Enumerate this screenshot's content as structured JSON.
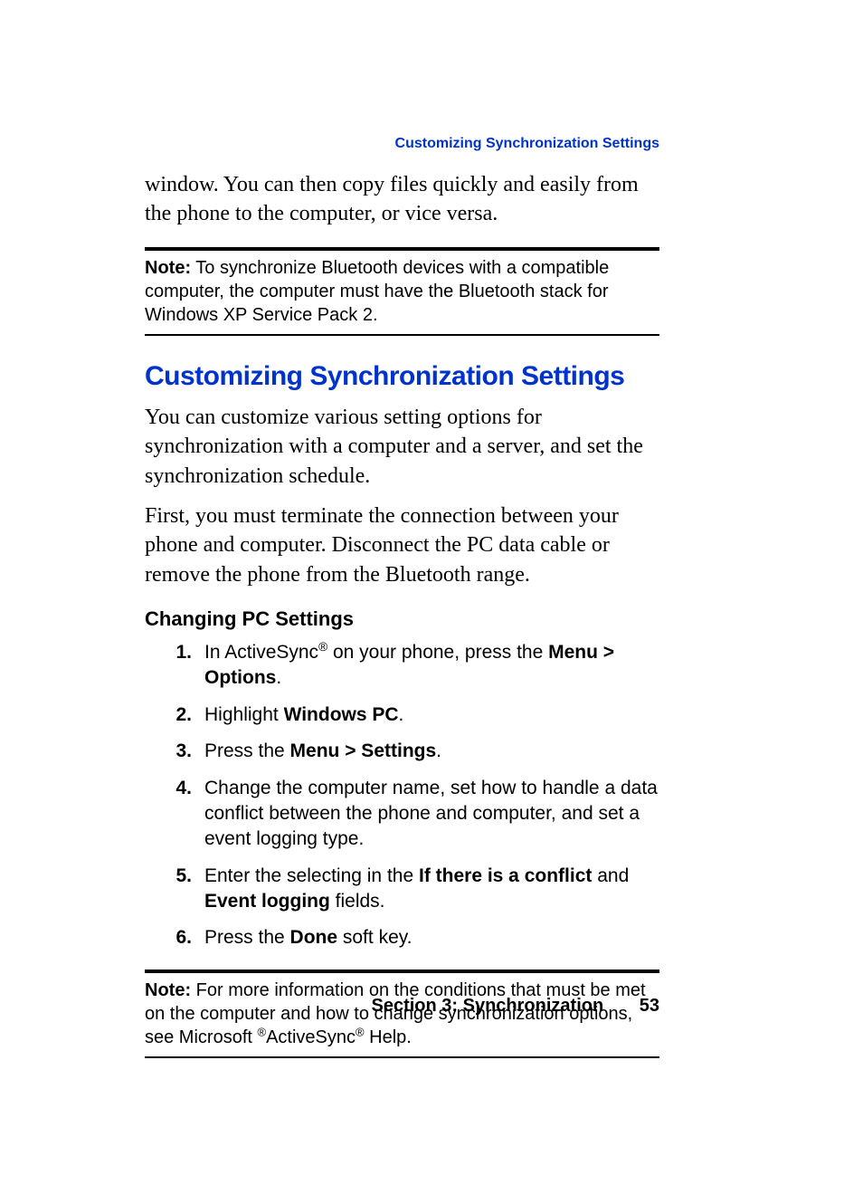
{
  "running_head": "Customizing Synchronization Settings",
  "intro_continuation": "window. You can then copy files quickly and easily from the phone to the computer, or vice versa.",
  "note1": {
    "label": "Note:",
    "text": " To synchronize Bluetooth devices with a compatible computer, the computer must have the Bluetooth stack for Windows XP Service Pack 2."
  },
  "heading": "Customizing Synchronization Settings",
  "para1": "You can customize various setting options for synchronization with a computer and a server, and set the synchronization schedule.",
  "para2": "First, you must terminate the connection between your phone and computer. Disconnect the PC data cable or remove the phone from the Bluetooth range.",
  "subheading": "Changing PC Settings",
  "steps": [
    {
      "n": "1.",
      "pre": "In ActiveSync",
      "sup": "®",
      "mid": " on your phone, press the ",
      "bold": "Menu > Options",
      "post": "."
    },
    {
      "n": "2.",
      "pre": "Highlight ",
      "bold": "Windows PC",
      "post": "."
    },
    {
      "n": "3.",
      "pre": "Press the ",
      "bold": "Menu > Settings",
      "post": "."
    },
    {
      "n": "4.",
      "text": "Change the computer name, set how to handle a data conflict between the phone and computer, and set a event logging type."
    },
    {
      "n": "5.",
      "pre": "Enter the selecting in the ",
      "bold": "If there is a conflict",
      "mid": " and ",
      "bold2": "Event logging",
      "post": " fields."
    },
    {
      "n": "6.",
      "pre": "Press the ",
      "bold": "Done",
      "post": " soft key."
    }
  ],
  "note2": {
    "label": "Note:",
    "text_pre": " For more information on the conditions that must be met on the computer and how to change synchronization options, see Microsoft ",
    "sup1": "®",
    "mid": "ActiveSync",
    "sup2": "®",
    "post": " Help."
  },
  "footer": {
    "section": "Section 3: Synchronization",
    "page": "53"
  }
}
